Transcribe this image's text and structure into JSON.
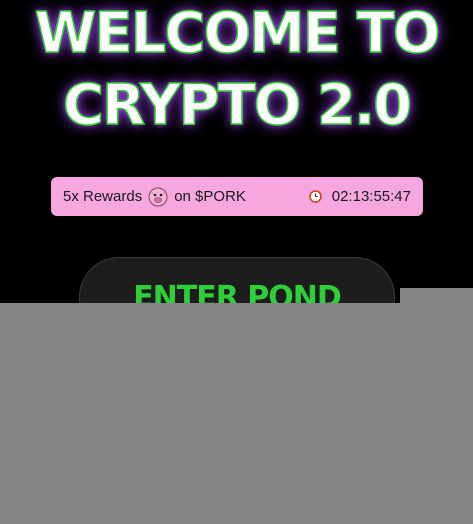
{
  "hero": {
    "line1": "WELCOME TO",
    "line2": "CRYPTO 2.0"
  },
  "promo": {
    "rewards_text": "5x Rewards",
    "token_icon": "pig-icon",
    "token_text": "on $PORK",
    "timer_icon": "clock-icon",
    "countdown": "02:13:55:47"
  },
  "cta": {
    "label": "ENTER POND"
  },
  "colors": {
    "background": "#000000",
    "title_glow": "#a846ff",
    "title_outline": "#2fd12f",
    "banner": "#f7a7e0",
    "cta_text": "#2ecf3a",
    "cta_bg": "#1d1d1d",
    "overlay": "#858585"
  }
}
